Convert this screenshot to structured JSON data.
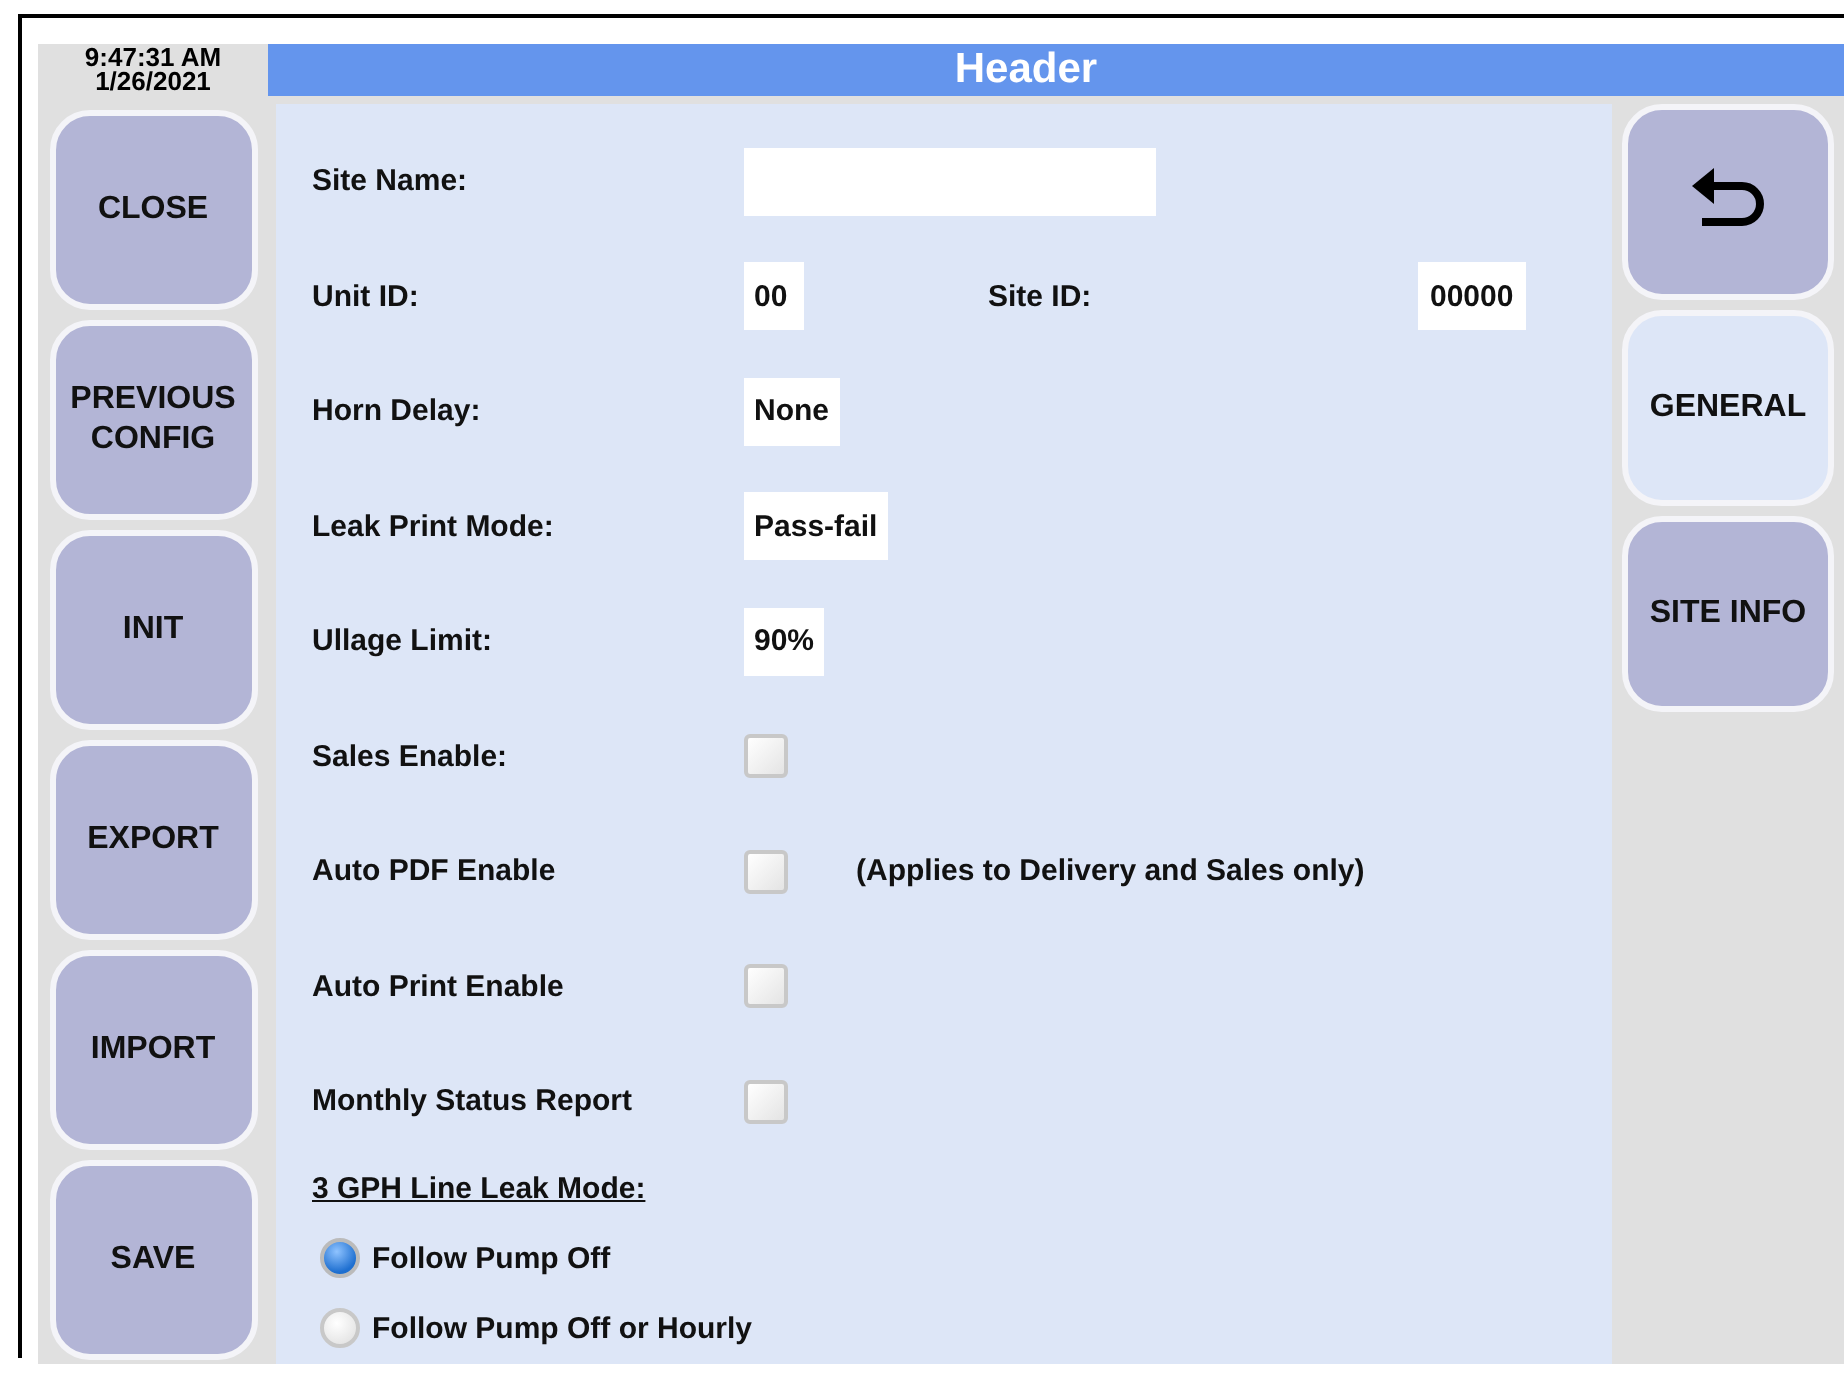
{
  "clock": {
    "time": "9:47:31 AM",
    "date": "1/26/2021"
  },
  "header": {
    "title": "Header"
  },
  "left_buttons": [
    "CLOSE",
    "PREVIOUS CONFIG",
    "INIT",
    "EXPORT",
    "IMPORT",
    "SAVE"
  ],
  "right_buttons": [
    {
      "kind": "icon",
      "selected": false
    },
    {
      "kind": "text",
      "label": "GENERAL",
      "selected": true
    },
    {
      "kind": "text",
      "label": "SITE INFO",
      "selected": false
    }
  ],
  "rows": [
    {
      "kind": "text",
      "label": "Site Name:"
    },
    {
      "kind": "text",
      "label": "Unit ID:",
      "value": "00",
      "second": {
        "label": "Site ID:",
        "value": "00000"
      }
    },
    {
      "kind": "text",
      "label": "Horn Delay:",
      "value": "None"
    },
    {
      "kind": "text",
      "label": "Leak Print Mode:",
      "value": "Pass-fail"
    },
    {
      "kind": "text",
      "label": "Ullage Limit:",
      "value": "90%"
    },
    {
      "kind": "checkbox",
      "label": "Sales Enable:",
      "checked": false
    },
    {
      "kind": "checkbox",
      "label": "Auto PDF Enable",
      "checked": false,
      "note": "(Applies to Delivery and Sales only)"
    },
    {
      "kind": "checkbox",
      "label": "Auto Print Enable",
      "checked": false
    },
    {
      "kind": "checkbox",
      "label": "Monthly Status Report",
      "checked": false
    }
  ],
  "line_leak": {
    "title": "3 GPH Line Leak Mode:",
    "options": [
      {
        "label": "Follow Pump Off",
        "selected": true
      },
      {
        "label": "Follow Pump Off or Hourly",
        "selected": false
      }
    ]
  }
}
